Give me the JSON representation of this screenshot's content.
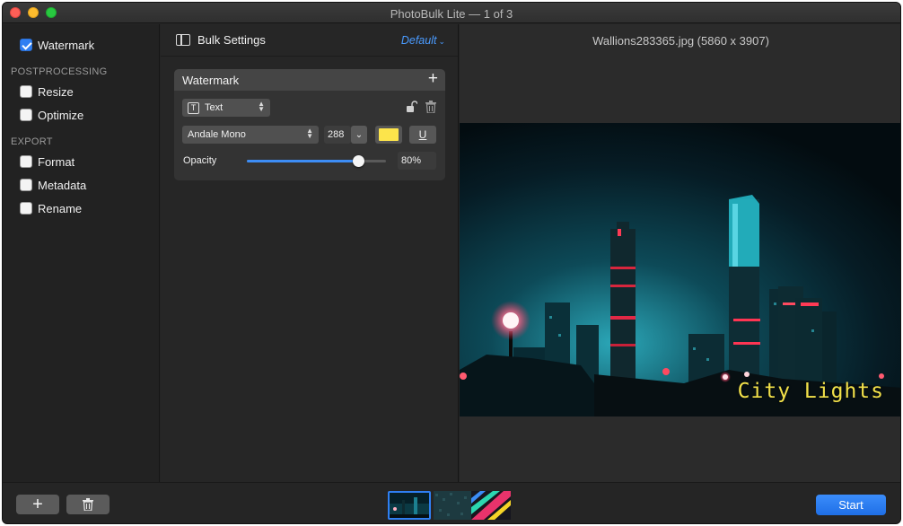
{
  "window": {
    "title": "PhotoBulk Lite — 1 of 3"
  },
  "sidebar": {
    "watermark": {
      "label": "Watermark",
      "checked": true
    },
    "postprocessing_header": "POSTPROCESSING",
    "resize": {
      "label": "Resize",
      "checked": false
    },
    "optimize": {
      "label": "Optimize",
      "checked": false
    },
    "export_header": "EXPORT",
    "format": {
      "label": "Format",
      "checked": false
    },
    "metadata": {
      "label": "Metadata",
      "checked": false
    },
    "rename": {
      "label": "Rename",
      "checked": false
    }
  },
  "settings": {
    "title": "Bulk Settings",
    "preset": "Default",
    "watermark_card": {
      "title": "Watermark",
      "type_select": "Text",
      "font_select": "Andale Mono",
      "font_size": "288",
      "color": "#fce44b",
      "underline_label": "U",
      "opacity_label": "Opacity",
      "opacity_value": "80%",
      "opacity_fraction": 0.8
    }
  },
  "preview": {
    "file_info": "Wallions283365.jpg (5860 x 3907)",
    "watermark_text": "City Lights",
    "watermark_color": "#f2e14a"
  },
  "bottom": {
    "add_label": "+",
    "start_label": "Start",
    "accent": "#2f7ff2"
  }
}
